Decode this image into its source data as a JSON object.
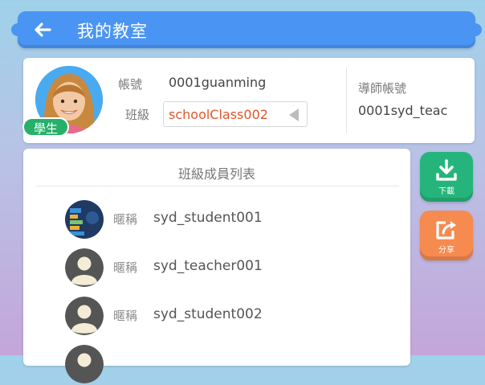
{
  "header": {
    "title": "我的教室"
  },
  "profile": {
    "role_badge": "學生",
    "account_label": "帳號",
    "account_value": "0001guanming",
    "class_label": "班級",
    "class_selected": "schoolClass002",
    "mentor_label": "導師帳號",
    "mentor_value": "0001syd_teac"
  },
  "members": {
    "title": "班級成員列表",
    "nickname_label": "暱稱",
    "items": [
      {
        "name": "syd_student001"
      },
      {
        "name": "syd_teacher001"
      },
      {
        "name": "syd_student002"
      }
    ]
  },
  "actions": {
    "download_label": "下載",
    "share_label": "分享"
  },
  "colors": {
    "header_blue": "#4a95f3",
    "badge_green": "#27b06a",
    "download_green": "#25b57c",
    "share_orange": "#f68a4f",
    "class_text": "#e0562c"
  }
}
